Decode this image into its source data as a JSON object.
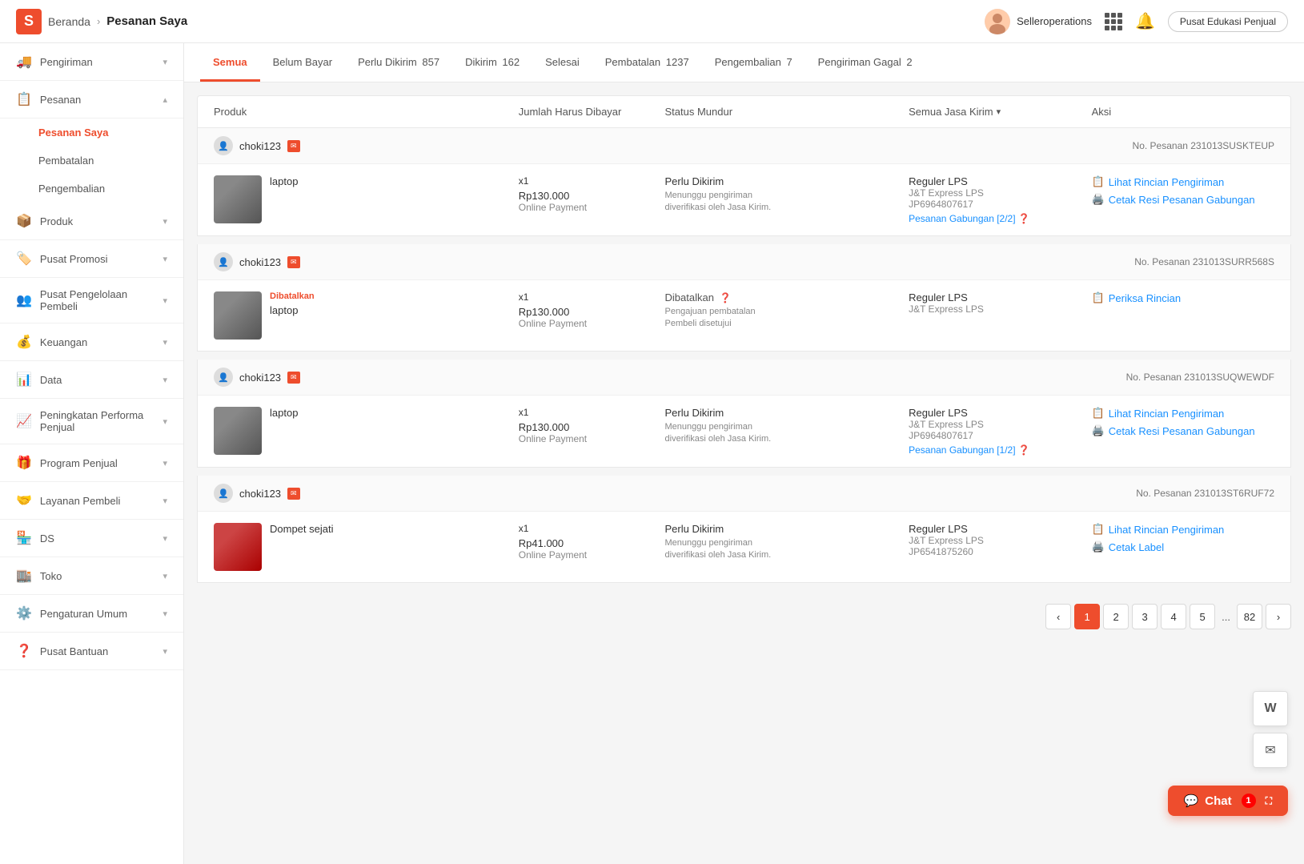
{
  "header": {
    "logo": "S",
    "breadcrumb_home": "Beranda",
    "breadcrumb_sep": "›",
    "breadcrumb_current": "Pesanan Saya",
    "username": "Selleroperations",
    "edu_btn": "Pusat Edukasi Penjual"
  },
  "sidebar": {
    "items": [
      {
        "id": "pengiriman",
        "icon": "🚚",
        "label": "Pengiriman",
        "expanded": false
      },
      {
        "id": "pesanan",
        "icon": "📋",
        "label": "Pesanan",
        "expanded": true
      },
      {
        "id": "produk",
        "icon": "📦",
        "label": "Produk",
        "expanded": false
      },
      {
        "id": "pusat-promosi",
        "icon": "🏷️",
        "label": "Pusat Promosi",
        "expanded": false
      },
      {
        "id": "pusat-pengelolaan",
        "icon": "👥",
        "label": "Pusat Pengelolaan Pembeli",
        "expanded": false
      },
      {
        "id": "keuangan",
        "icon": "💰",
        "label": "Keuangan",
        "expanded": false
      },
      {
        "id": "data",
        "icon": "📊",
        "label": "Data",
        "expanded": false
      },
      {
        "id": "peningkatan",
        "icon": "📈",
        "label": "Peningkatan Performa Penjual",
        "expanded": false
      },
      {
        "id": "program-penjual",
        "icon": "🎁",
        "label": "Program Penjual",
        "expanded": false
      },
      {
        "id": "layanan-pembeli",
        "icon": "🤝",
        "label": "Layanan Pembeli",
        "expanded": false
      },
      {
        "id": "ds",
        "icon": "🏪",
        "label": "DS",
        "expanded": false
      },
      {
        "id": "toko",
        "icon": "🏬",
        "label": "Toko",
        "expanded": false
      },
      {
        "id": "pengaturan",
        "icon": "⚙️",
        "label": "Pengaturan Umum",
        "expanded": false
      },
      {
        "id": "pusat-bantuan",
        "icon": "❓",
        "label": "Pusat Bantuan",
        "expanded": false
      }
    ],
    "sub_items": [
      {
        "label": "Pesanan Saya",
        "active": true
      },
      {
        "label": "Pembatalan",
        "active": false
      },
      {
        "label": "Pengembalian",
        "active": false
      }
    ]
  },
  "tabs": [
    {
      "label": "Semua",
      "count": "",
      "active": true
    },
    {
      "label": "Belum Bayar",
      "count": "",
      "active": false
    },
    {
      "label": "Perlu Dikirim",
      "count": "857",
      "active": false
    },
    {
      "label": "Dikirim",
      "count": "162",
      "active": false
    },
    {
      "label": "Selesai",
      "count": "",
      "active": false
    },
    {
      "label": "Pembatalan",
      "count": "1237",
      "active": false
    },
    {
      "label": "Pengembalian",
      "count": "7",
      "active": false
    },
    {
      "label": "Pengiriman Gagal",
      "count": "2",
      "active": false
    }
  ],
  "table_header": {
    "product": "Produk",
    "amount": "Jumlah Harus Dibayar",
    "status": "Status Mundur",
    "shipping_filter": "Semua Jasa Kirim",
    "action": "Aksi"
  },
  "orders": [
    {
      "id": "order1",
      "user": "choki123",
      "order_number": "No. Pesanan 231013SUSKTEUP",
      "product_name": "laptop",
      "product_tag": "",
      "quantity": "x1",
      "price": "Rp130.000",
      "payment": "Online Payment",
      "status": "Perlu Dikirim",
      "status_desc": "Menunggu pengiriman diverifikasi oleh Jasa Kirim.",
      "cancelled": false,
      "shipping_service": "Reguler LPS",
      "courier": "J&T Express LPS",
      "tracking": "JP6964807617",
      "combined": "Pesanan Gabungan [2/2]",
      "actions": [
        {
          "label": "Lihat Rincian Pengiriman",
          "icon": "📋"
        },
        {
          "label": "Cetak Resi Pesanan Gabungan",
          "icon": "🖨️"
        }
      ]
    },
    {
      "id": "order2",
      "user": "choki123",
      "order_number": "No. Pesanan 231013SURR568S",
      "product_name": "laptop",
      "product_tag": "Dibatalkan",
      "quantity": "x1",
      "price": "Rp130.000",
      "payment": "Online Payment",
      "status": "Dibatalkan",
      "status_desc": "Pengajuan pembatalan Pembeli disetujui",
      "cancelled": true,
      "shipping_service": "Reguler LPS",
      "courier": "J&T Express LPS",
      "tracking": "",
      "combined": "",
      "actions": [
        {
          "label": "Periksa Rincian",
          "icon": "📋"
        }
      ]
    },
    {
      "id": "order3",
      "user": "choki123",
      "order_number": "No. Pesanan 231013SUQWEWDF",
      "product_name": "laptop",
      "product_tag": "",
      "quantity": "x1",
      "price": "Rp130.000",
      "payment": "Online Payment",
      "status": "Perlu Dikirim",
      "status_desc": "Menunggu pengiriman diverifikasi oleh Jasa Kirim.",
      "cancelled": false,
      "shipping_service": "Reguler LPS",
      "courier": "J&T Express LPS",
      "tracking": "JP6964807617",
      "combined": "Pesanan Gabungan [1/2]",
      "actions": [
        {
          "label": "Lihat Rincian Pengiriman",
          "icon": "📋"
        },
        {
          "label": "Cetak Resi Pesanan Gabungan",
          "icon": "🖨️"
        }
      ]
    },
    {
      "id": "order4",
      "user": "choki123",
      "order_number": "No. Pesanan 231013ST6RUF72",
      "product_name": "Dompet sejati",
      "product_tag": "",
      "quantity": "x1",
      "price": "Rp41.000",
      "payment": "Online Payment",
      "status": "Perlu Dikirim",
      "status_desc": "Menunggu pengiriman diverifikasi oleh Jasa Kirim.",
      "cancelled": false,
      "shipping_service": "Reguler LPS",
      "courier": "J&T Express LPS",
      "tracking": "JP6541875260",
      "combined": "",
      "actions": [
        {
          "label": "Lihat Rincian Pengiriman",
          "icon": "📋"
        },
        {
          "label": "Cetak Label",
          "icon": "🖨️"
        }
      ]
    }
  ],
  "pagination": {
    "prev": "‹",
    "pages": [
      "1",
      "2",
      "3",
      "4",
      "5",
      "...",
      "82"
    ],
    "next": "›",
    "active_page": "1"
  },
  "float_buttons": [
    {
      "label": "W",
      "icon": "W"
    },
    {
      "label": "mail-icon",
      "icon": "✉"
    }
  ],
  "chat_button": {
    "label": "Chat",
    "count": "1"
  }
}
